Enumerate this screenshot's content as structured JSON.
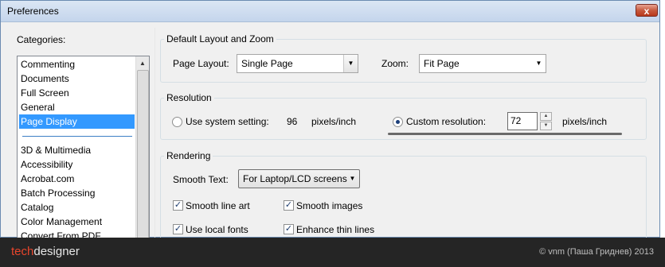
{
  "window": {
    "title": "Preferences",
    "close_glyph": "x"
  },
  "categories": {
    "label": "Categories:",
    "group1": [
      "Commenting",
      "Documents",
      "Full Screen",
      "General",
      "Page Display"
    ],
    "group2": [
      "3D & Multimedia",
      "Accessibility",
      "Acrobat.com",
      "Batch Processing",
      "Catalog",
      "Color Management",
      "Convert From PDF"
    ],
    "selected": "Page Display"
  },
  "layout_zoom": {
    "title": "Default Layout and Zoom",
    "page_layout_label": "Page Layout:",
    "page_layout_value": "Single Page",
    "zoom_label": "Zoom:",
    "zoom_value": "Fit Page"
  },
  "resolution": {
    "title": "Resolution",
    "system_label": "Use system setting:",
    "system_value": "96",
    "system_unit": "pixels/inch",
    "custom_label": "Custom resolution:",
    "custom_value": "72",
    "custom_unit": "pixels/inch",
    "selected": "custom"
  },
  "rendering": {
    "title": "Rendering",
    "smooth_text_label": "Smooth Text:",
    "smooth_text_value": "For Laptop/LCD screens",
    "checkboxes": [
      {
        "label": "Smooth line art",
        "checked": true
      },
      {
        "label": "Smooth images",
        "checked": true
      },
      {
        "label": "Use local fonts",
        "checked": true
      },
      {
        "label": "Enhance thin lines",
        "checked": true
      }
    ]
  },
  "footer": {
    "brand_tech": "tech",
    "brand_designer": "designer",
    "copyright": "© vnm (Паша Гриднев) 2013"
  },
  "icons": {
    "dropdown": "▼",
    "scroll_up": "▲",
    "check": "✓",
    "spin_up": "▲",
    "spin_down": "▼"
  },
  "colors": {
    "selection": "#3399ff",
    "brand_accent": "#e8452c"
  }
}
